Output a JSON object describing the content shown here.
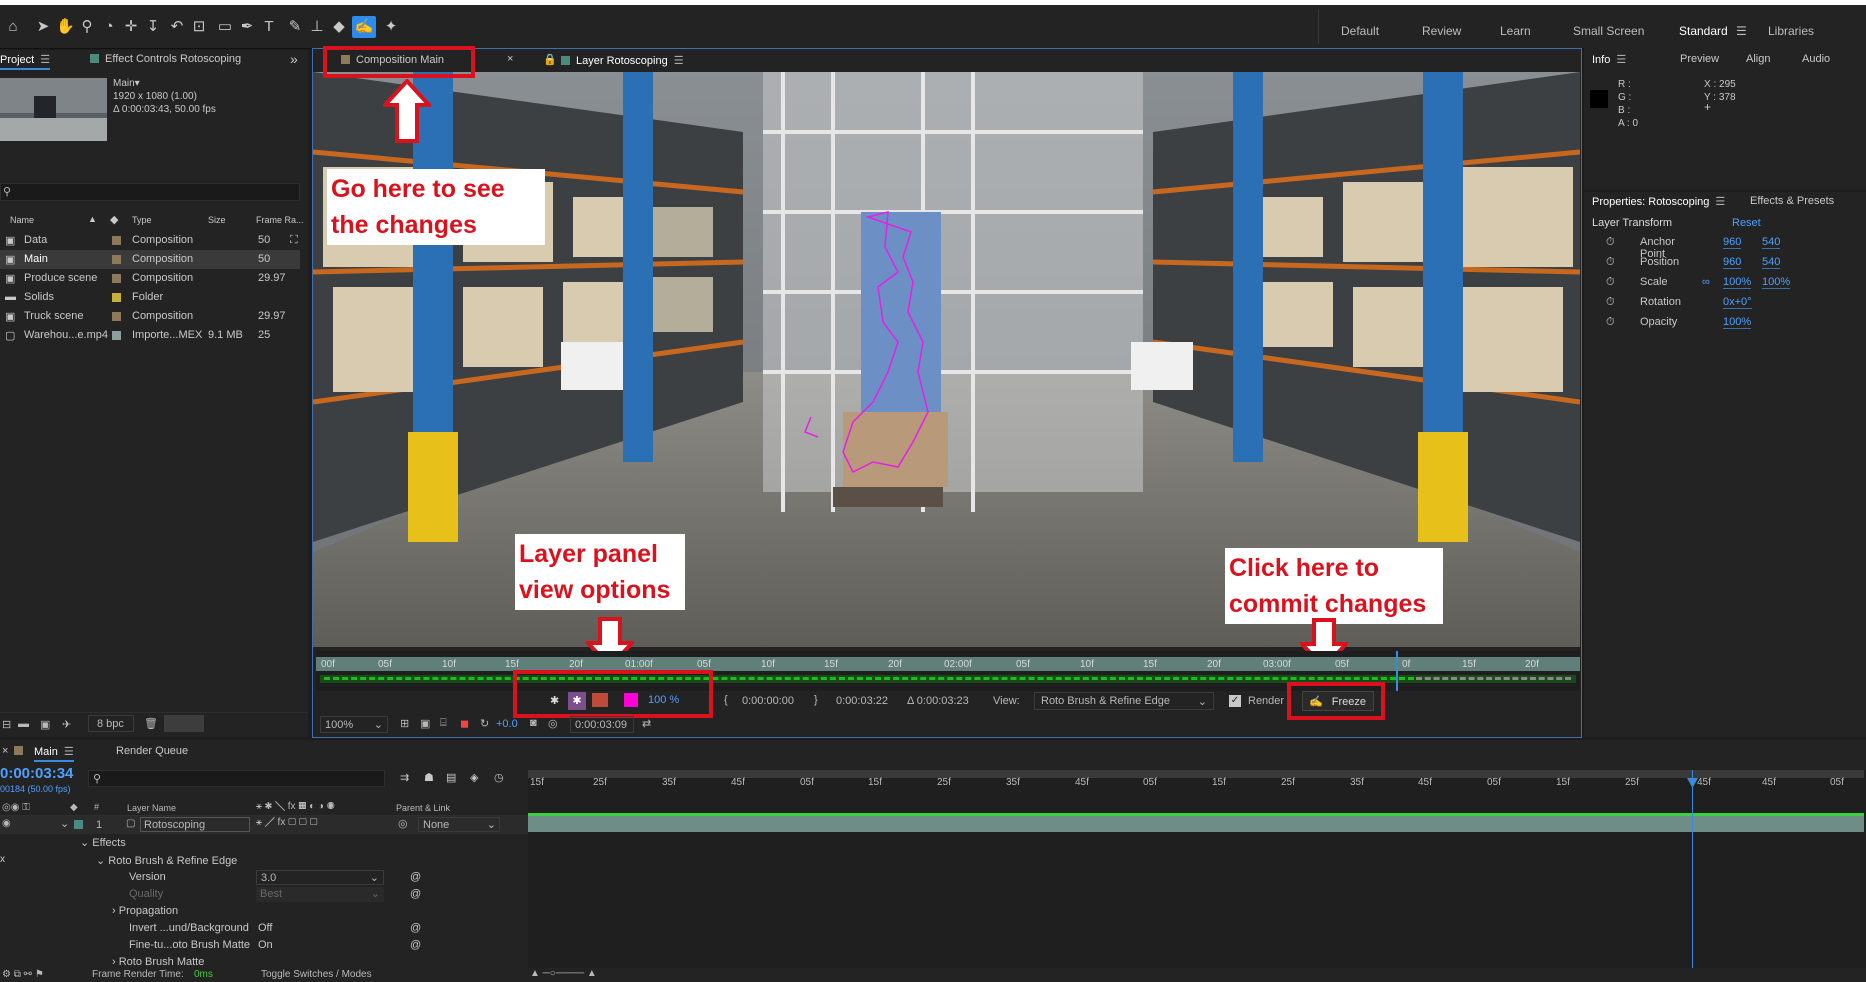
{
  "toolbar": {
    "workspaces": [
      "Default",
      "Review",
      "Learn",
      "Small Screen",
      "Standard",
      "Libraries"
    ],
    "active_workspace": "Standard"
  },
  "project_panel": {
    "tab_project": "Project",
    "tab_effect_controls": "Effect Controls Rotoscoping",
    "comp_name": "Main▾",
    "comp_size": "1920 x 1080 (1.00)",
    "comp_duration": "Δ 0:00:03:43, 50.00 fps",
    "search_placeholder": "",
    "columns": [
      "Name",
      "Type",
      "Size",
      "Frame Ra..."
    ],
    "items": [
      {
        "name": "Data",
        "type": "Composition",
        "size": "",
        "fps": "50",
        "color": "#8c7a5b"
      },
      {
        "name": "Main",
        "type": "Composition",
        "size": "",
        "fps": "50",
        "color": "#8c7a5b",
        "selected": true
      },
      {
        "name": "Produce scene",
        "type": "Composition",
        "size": "",
        "fps": "29.97",
        "color": "#8c7a5b"
      },
      {
        "name": "Solids",
        "type": "Folder",
        "size": "",
        "fps": "",
        "color": "#c9b03a"
      },
      {
        "name": "Truck scene",
        "type": "Composition",
        "size": "",
        "fps": "29.97",
        "color": "#8c7a5b"
      },
      {
        "name": "Warehou...e.mp4",
        "type": "Importe...MEX",
        "size": "9.1 MB",
        "fps": "25",
        "color": "#8da0a0"
      }
    ],
    "bpc": "8 bpc"
  },
  "viewer": {
    "tab_comp": "Composition Main",
    "tab_layer": "Layer Rotoscoping",
    "ruler_ticks": [
      "00f",
      "05f",
      "10f",
      "15f",
      "20f",
      "01:00f",
      "05f",
      "10f",
      "15f",
      "20f",
      "02:00f",
      "05f",
      "10f",
      "15f",
      "20f",
      "03:00f",
      "05f",
      "0f",
      "15f",
      "20f"
    ],
    "zoom_pct": "100 %",
    "time_in": "0:00:00:00",
    "time_out": "0:00:03:22",
    "time_dur": "Δ 0:00:03:23",
    "view_label": "View:",
    "view_value": "Roto Brush & Refine Edge",
    "render_label": "Render",
    "freeze_label": "Freeze",
    "mag": "100%",
    "exposure": "+0.0",
    "current_time": "0:00:03:09"
  },
  "annotations": {
    "go_here": "Go here to see\nthe changes",
    "layer_panel": "Layer panel\nview options",
    "click_here": "Click here to\ncommit changes"
  },
  "info_panel": {
    "tabs": [
      "Info",
      "Preview",
      "Align",
      "Audio"
    ],
    "r": "R :",
    "g": "G :",
    "b": "B :",
    "a": "A :  0",
    "x": "X : 295",
    "y": "Y : 378"
  },
  "properties_panel": {
    "tab": "Properties: Rotoscoping",
    "tab2": "Effects & Presets",
    "section": "Layer Transform",
    "reset": "Reset",
    "rows": [
      {
        "label": "Anchor Point",
        "v1": "960",
        "v2": "540"
      },
      {
        "label": "Position",
        "v1": "960",
        "v2": "540"
      },
      {
        "label": "Scale",
        "v1": "100%",
        "v2": "100%"
      },
      {
        "label": "Rotation",
        "v1": "0x+0°",
        "v2": ""
      },
      {
        "label": "Opacity",
        "v1": "100%",
        "v2": ""
      }
    ]
  },
  "timeline": {
    "tab": "Main",
    "render_queue": "Render Queue",
    "timecode": "0:00:03:34",
    "frames": "00184 (50.00 fps)",
    "col_layer_name": "Layer Name",
    "col_parent": "Parent & Link",
    "layer_num": "1",
    "layer_name": "Rotoscoping",
    "parent_value": "None",
    "effects": "Effects",
    "effect_name": "Roto Brush & Refine Edge",
    "props": [
      {
        "label": "Version",
        "value": "3.0"
      },
      {
        "label": "Quality",
        "value": "Best"
      },
      {
        "label": "Propagation",
        "value": ""
      },
      {
        "label": "Invert ...und/Background",
        "value": "Off"
      },
      {
        "label": "Fine-tu...oto Brush Matte",
        "value": "On"
      },
      {
        "label": "Roto Brush Matte",
        "value": ""
      }
    ],
    "ruler": [
      "15f",
      "25f",
      "35f",
      "45f",
      "05f",
      "15f",
      "25f",
      "35f",
      "45f",
      "05f",
      "15f",
      "25f",
      "35f",
      "45f",
      "05f",
      "15f",
      "25f",
      "45f",
      "45f",
      "05f"
    ],
    "footer_render_time": "Frame Render Time:",
    "footer_render_ms": "0ms",
    "footer_toggle": "Toggle Switches / Modes"
  }
}
